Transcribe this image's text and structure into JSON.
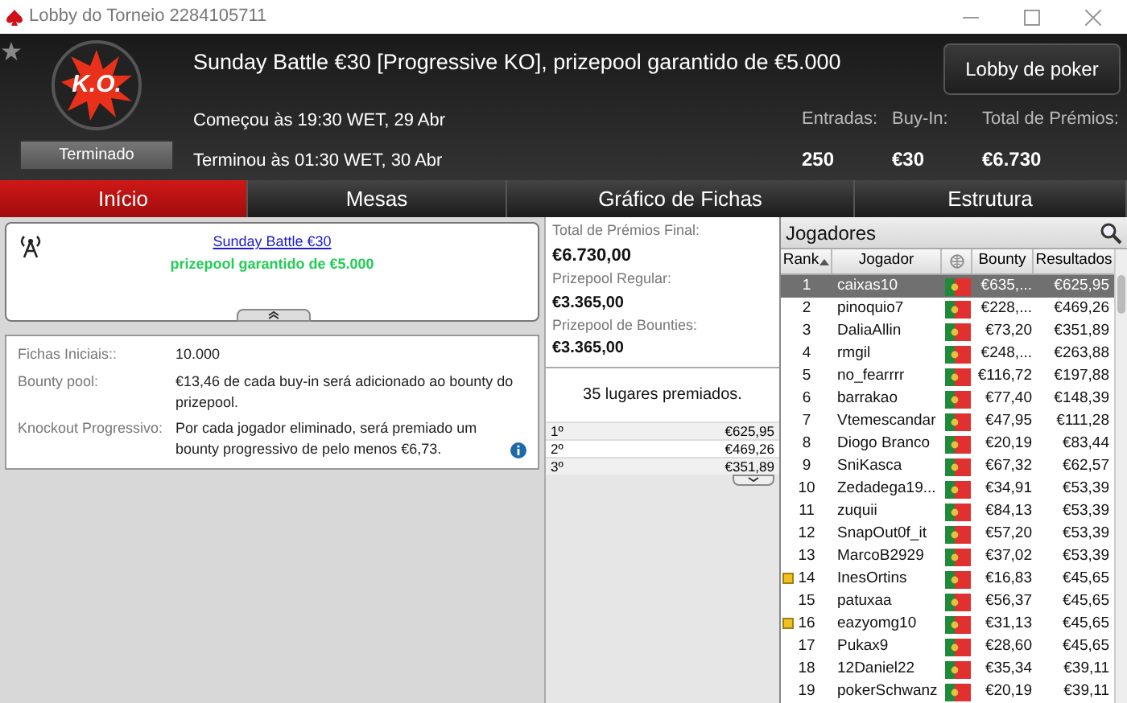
{
  "window": {
    "title": "Lobby do Torneio 2284105711"
  },
  "header": {
    "badge": "K.O.",
    "status": "Terminado",
    "title": "Sunday Battle €30 [Progressive KO], prizepool garantido de €5.000",
    "started": "Começou às 19:30 WET, 29 Abr",
    "ended": "Terminou às 01:30 WET, 30 Abr",
    "lobby_button": "Lobby de poker",
    "stats": [
      {
        "label": "Entradas:",
        "value": "250"
      },
      {
        "label": "Buy-In:",
        "value": "€30"
      },
      {
        "label": "Total de Prémios:",
        "value": "€6.730"
      }
    ]
  },
  "tabs": [
    {
      "label": "Início",
      "selected": true
    },
    {
      "label": "Mesas",
      "selected": false
    },
    {
      "label": "Gráfico de Fichas",
      "selected": false
    },
    {
      "label": "Estrutura",
      "selected": false
    }
  ],
  "news": {
    "link": "Sunday Battle €30",
    "subtitle": "prizepool garantido de €5.000"
  },
  "info": [
    {
      "label": "Fichas Iniciais::",
      "value": "10.000"
    },
    {
      "label": "Bounty pool:",
      "value": "€13,46 de cada buy-in será adicionado ao bounty do prizepool."
    },
    {
      "label": "Knockout Progressivo:",
      "value": "Por cada jogador eliminado, será premiado um bounty progressivo de pelo menos €6,73."
    }
  ],
  "prizes": {
    "items": [
      {
        "label": "Total de Prémios Final:",
        "value": "€6.730,00"
      },
      {
        "label": "Prizepool Regular:",
        "value": "€3.365,00"
      },
      {
        "label": "Prizepool de Bounties:",
        "value": "€3.365,00"
      }
    ],
    "places": "35 lugares premiados.",
    "payouts": [
      {
        "place": "1º",
        "amount": "€625,95"
      },
      {
        "place": "2º",
        "amount": "€469,26"
      },
      {
        "place": "3º",
        "amount": "€351,89"
      }
    ]
  },
  "players": {
    "title": "Jogadores",
    "columns": [
      "Rank",
      "Jogador",
      "Bounty",
      "Resultados"
    ],
    "rows": [
      {
        "rank": "1",
        "name": "caixas10",
        "bounty": "€635,...",
        "result": "€625,95",
        "selected": true,
        "marked": false
      },
      {
        "rank": "2",
        "name": "pinoquio7",
        "bounty": "€228,...",
        "result": "€469,26",
        "selected": false,
        "marked": false
      },
      {
        "rank": "3",
        "name": "DaliaAllin",
        "bounty": "€73,20",
        "result": "€351,89",
        "selected": false,
        "marked": false
      },
      {
        "rank": "4",
        "name": "rmgil",
        "bounty": "€248,...",
        "result": "€263,88",
        "selected": false,
        "marked": false
      },
      {
        "rank": "5",
        "name": "no_fearrrr",
        "bounty": "€116,72",
        "result": "€197,88",
        "selected": false,
        "marked": false
      },
      {
        "rank": "6",
        "name": "barrakao",
        "bounty": "€77,40",
        "result": "€148,39",
        "selected": false,
        "marked": false
      },
      {
        "rank": "7",
        "name": "Vtemescandar",
        "bounty": "€47,95",
        "result": "€111,28",
        "selected": false,
        "marked": false
      },
      {
        "rank": "8",
        "name": "Diogo Branco",
        "bounty": "€20,19",
        "result": "€83,44",
        "selected": false,
        "marked": false
      },
      {
        "rank": "9",
        "name": "SniKasca",
        "bounty": "€67,32",
        "result": "€62,57",
        "selected": false,
        "marked": false
      },
      {
        "rank": "10",
        "name": "Zedadega19...",
        "bounty": "€34,91",
        "result": "€53,39",
        "selected": false,
        "marked": false
      },
      {
        "rank": "11",
        "name": "zuquii",
        "bounty": "€84,13",
        "result": "€53,39",
        "selected": false,
        "marked": false
      },
      {
        "rank": "12",
        "name": "SnapOut0f_it",
        "bounty": "€57,20",
        "result": "€53,39",
        "selected": false,
        "marked": false
      },
      {
        "rank": "13",
        "name": "MarcoB2929",
        "bounty": "€37,02",
        "result": "€53,39",
        "selected": false,
        "marked": false
      },
      {
        "rank": "14",
        "name": "InesOrtins",
        "bounty": "€16,83",
        "result": "€45,65",
        "selected": false,
        "marked": true
      },
      {
        "rank": "15",
        "name": "patuxaa",
        "bounty": "€56,37",
        "result": "€45,65",
        "selected": false,
        "marked": false
      },
      {
        "rank": "16",
        "name": "eazyomg10",
        "bounty": "€31,13",
        "result": "€45,65",
        "selected": false,
        "marked": true
      },
      {
        "rank": "17",
        "name": "Pukax9",
        "bounty": "€28,60",
        "result": "€45,65",
        "selected": false,
        "marked": false
      },
      {
        "rank": "18",
        "name": "12Daniel22",
        "bounty": "€35,34",
        "result": "€39,11",
        "selected": false,
        "marked": false
      },
      {
        "rank": "19",
        "name": "pokerSchwanz",
        "bounty": "€20,19",
        "result": "€39,11",
        "selected": false,
        "marked": false
      }
    ]
  }
}
